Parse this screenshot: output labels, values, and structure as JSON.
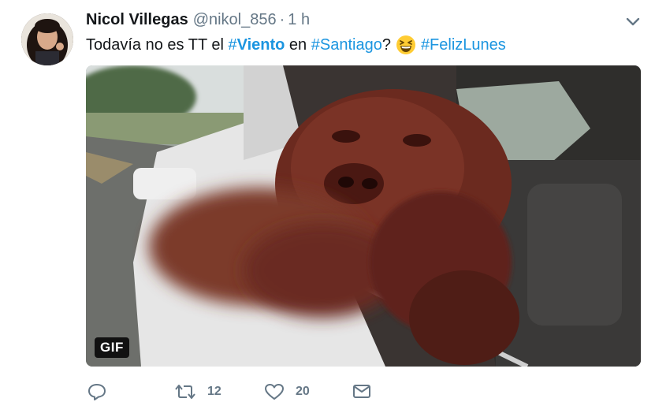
{
  "tweet": {
    "author_name": "Nicol Villegas",
    "handle": "@nikol_856",
    "separator": "·",
    "time": "1 h",
    "text_before": "Todavía no es TT el ",
    "hashtag_viento_prefix": "#",
    "hashtag_viento": "Viento",
    "text_middle": " en ",
    "hashtag_santiago": "#Santiago",
    "text_question": "?",
    "emoji": "grinning-squinting-face",
    "hashtag_felizlunes": "#FelizLunes"
  },
  "media": {
    "badge_label": "GIF"
  },
  "actions": {
    "reply_icon": "reply-icon",
    "retweet_count": "12",
    "like_count": "20",
    "message_icon": "envelope-icon"
  },
  "colors": {
    "link": "#1b95e0",
    "secondary_text": "#657786",
    "primary_text": "#14171a"
  }
}
